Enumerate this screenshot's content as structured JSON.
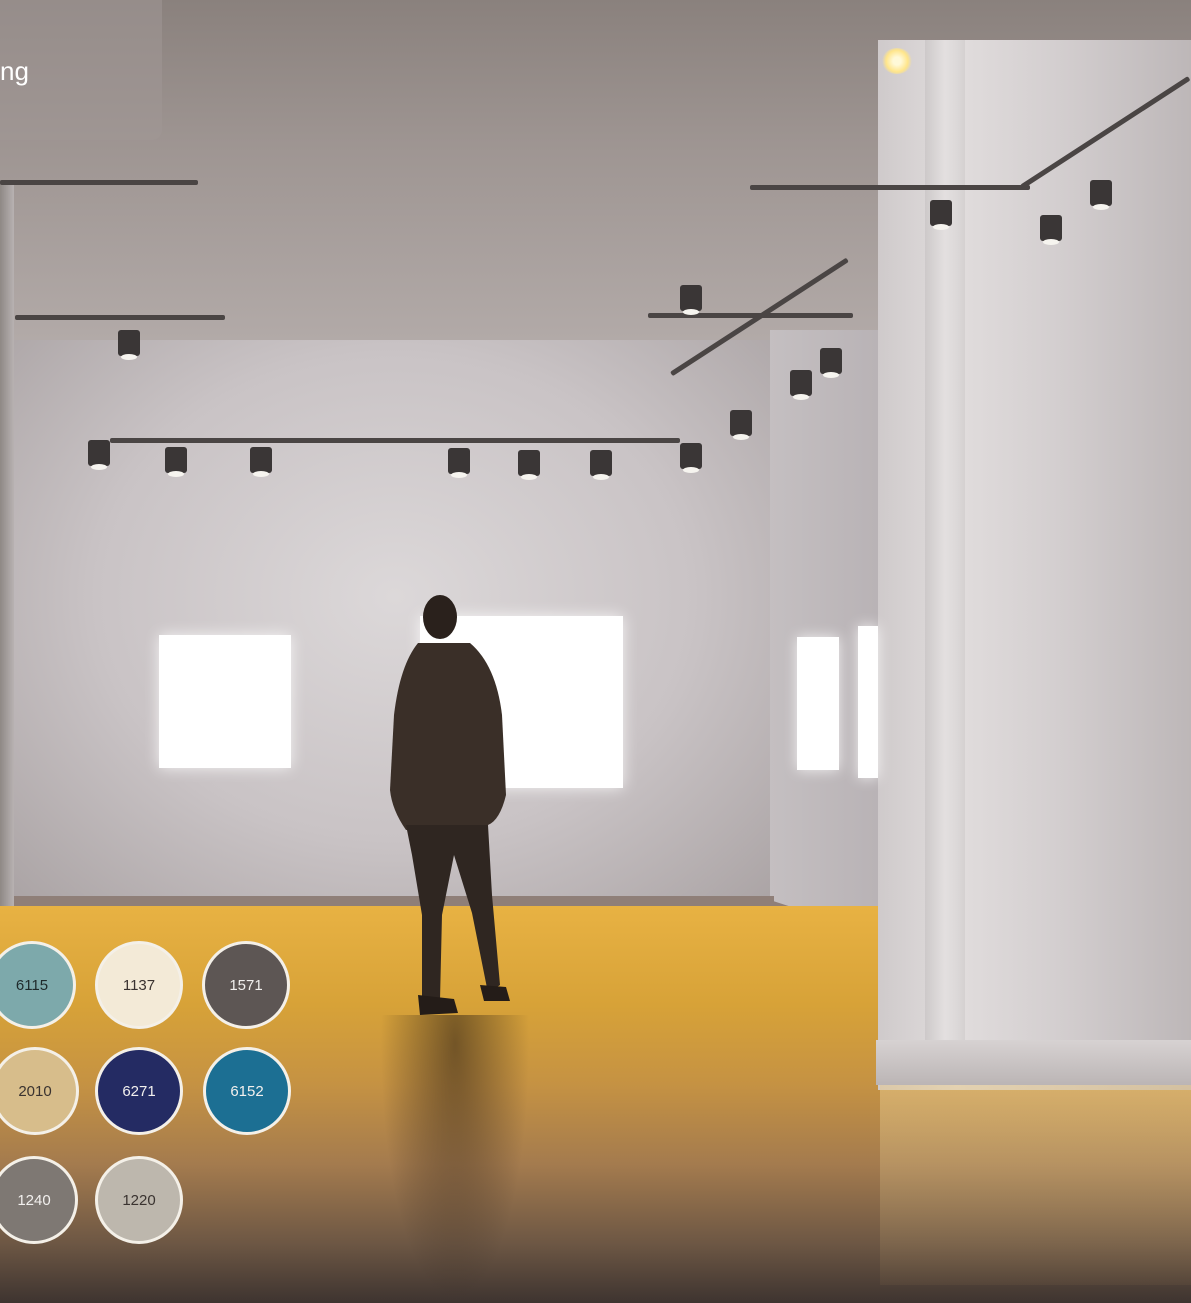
{
  "overlay": {
    "title": "ng"
  },
  "swatches": [
    {
      "code": "6115",
      "color": "#7da9ab",
      "text_color": "#1f2a2b"
    },
    {
      "code": "1137",
      "color": "#f3ead7",
      "text_color": "#3a3330"
    },
    {
      "code": "1571",
      "color": "#5d5654",
      "text_color": "#f2f0ee"
    },
    {
      "code": "2010",
      "color": "#d7bd8b",
      "text_color": "#3a3330"
    },
    {
      "code": "6271",
      "color": "#242b63",
      "text_color": "#f2f0ee"
    },
    {
      "code": "6152",
      "color": "#1c6f93",
      "text_color": "#f2f0ee"
    },
    {
      "code": "1240",
      "color": "#7e7873",
      "text_color": "#f2f0ee"
    },
    {
      "code": "1220",
      "color": "#bdb7ad",
      "text_color": "#3a3330"
    }
  ]
}
